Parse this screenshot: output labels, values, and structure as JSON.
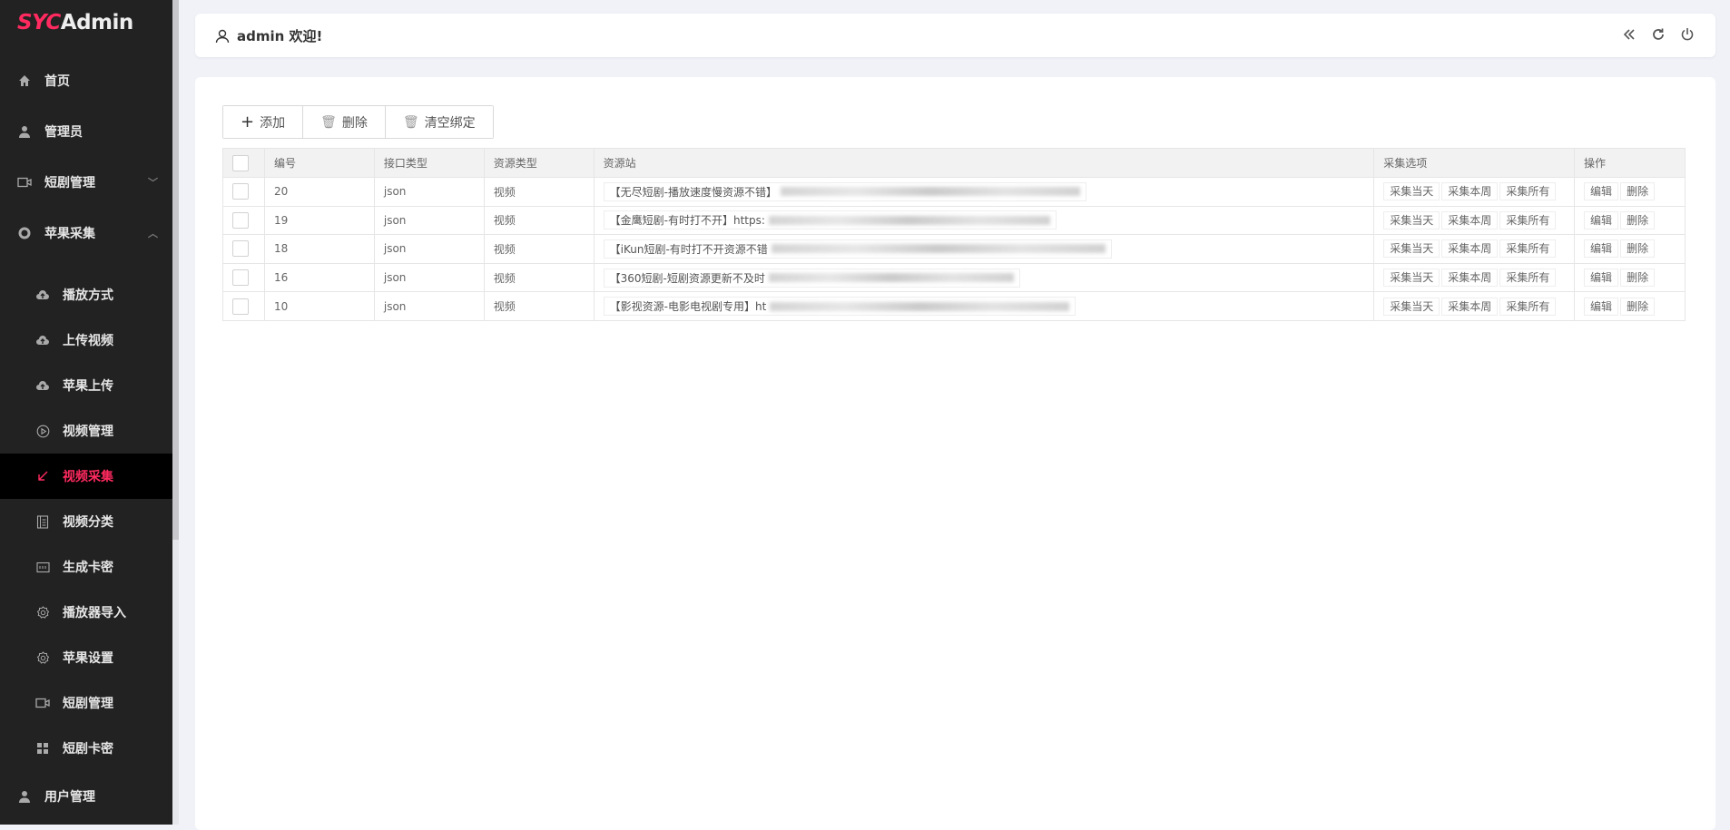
{
  "sidebar": {
    "logo": {
      "brand": "SYC",
      "suffix": "Admin"
    },
    "top_items": [
      {
        "label": "首页",
        "icon": "home-icon"
      },
      {
        "label": "管理员",
        "icon": "user-icon"
      },
      {
        "label": "短剧管理",
        "icon": "video-camera-icon"
      },
      {
        "label": "苹果采集",
        "icon": "circle-icon"
      }
    ],
    "sub_items": [
      {
        "label": "播放方式",
        "icon": "cloud-upload-icon"
      },
      {
        "label": "上传视频",
        "icon": "cloud-upload-icon"
      },
      {
        "label": "苹果上传",
        "icon": "cloud-upload-icon"
      },
      {
        "label": "视频管理",
        "icon": "play-circle-icon"
      },
      {
        "label": "视频采集",
        "icon": "arrow-down-left-icon",
        "active": true
      },
      {
        "label": "视频分类",
        "icon": "list-icon"
      },
      {
        "label": "生成卡密",
        "icon": "card-icon"
      },
      {
        "label": "播放器导入",
        "icon": "gear-icon"
      },
      {
        "label": "苹果设置",
        "icon": "gear-icon"
      },
      {
        "label": "短剧管理",
        "icon": "video-camera-icon"
      },
      {
        "label": "短剧卡密",
        "icon": "grid-icon"
      }
    ],
    "bottom_item": {
      "label": "用户管理",
      "icon": "user-icon"
    },
    "accent": "#ff2a5f"
  },
  "header": {
    "welcome": "admin 欢迎!",
    "icons": [
      "double-chevron-left-icon",
      "refresh-icon",
      "power-icon"
    ]
  },
  "toolbar": {
    "add": "添加",
    "delete": "删除",
    "clear": "清空绑定"
  },
  "table": {
    "columns": [
      "编号",
      "接口类型",
      "资源类型",
      "资源站",
      "采集选项",
      "操作"
    ],
    "rows": [
      {
        "id": "20",
        "api": "json",
        "type": "视频",
        "source": "【无尽短剧-播放速度慢资源不错】"
      },
      {
        "id": "19",
        "api": "json",
        "type": "视频",
        "source": "【金鹰短剧-有时打不开】https:"
      },
      {
        "id": "18",
        "api": "json",
        "type": "视频",
        "source": "【iKun短剧-有时打不开资源不错"
      },
      {
        "id": "16",
        "api": "json",
        "type": "视频",
        "source": "【360短剧-短剧资源更新不及时"
      },
      {
        "id": "10",
        "api": "json",
        "type": "视频",
        "source": "【影视资源-电影电视剧专用】ht"
      }
    ],
    "collect_buttons": [
      "采集当天",
      "采集本周",
      "采集所有"
    ],
    "action_buttons": [
      "编辑",
      "删除"
    ]
  }
}
